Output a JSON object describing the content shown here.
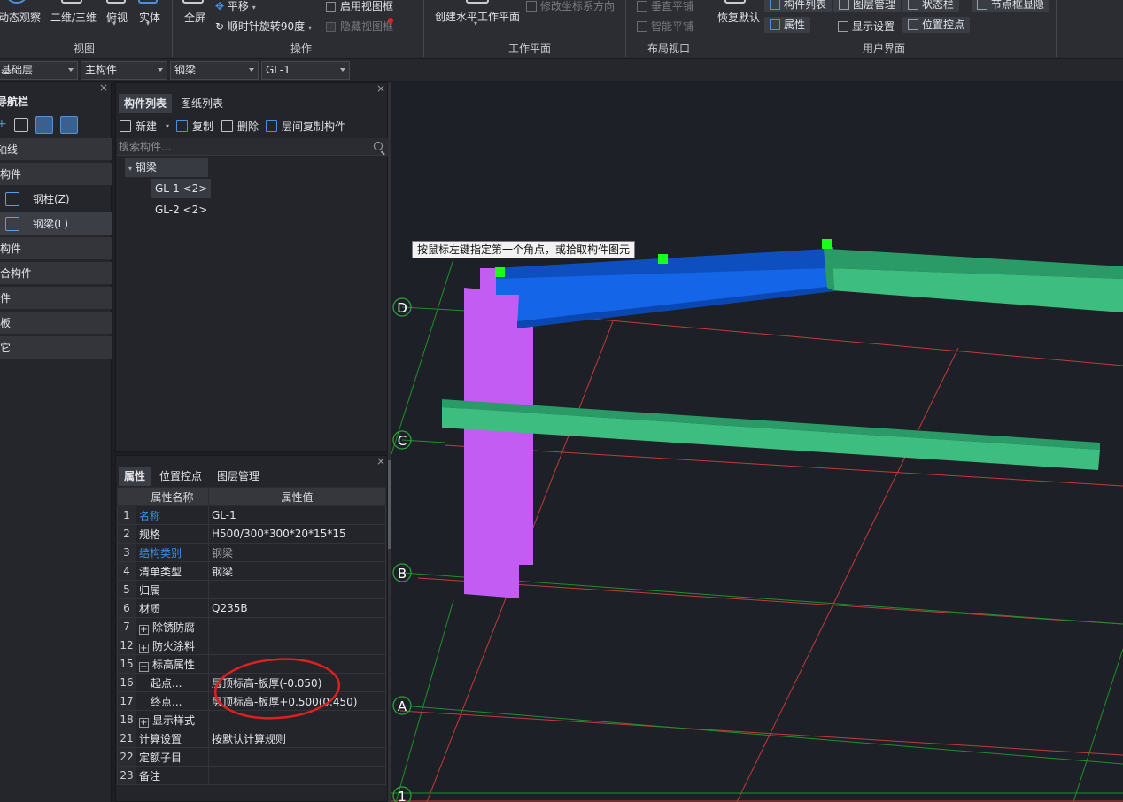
{
  "ribbon": {
    "view_group": {
      "label": "视图",
      "buttons": [
        "动态观察",
        "二维/三维",
        "俯视",
        "实体"
      ]
    },
    "ops_group": {
      "label": "操作",
      "fullscreen": "全屏",
      "pan": "平移",
      "rotate_cw": "顺时针旋转90度",
      "enable_view_frame": "启用视图框",
      "hide_view_frame": "隐藏视图框"
    },
    "workplane_group": {
      "label": "工作平面",
      "create_horizontal": "创建水平工作平面",
      "modify_coord_dir": "修改坐标系方向"
    },
    "layout_group": {
      "label": "布局视口",
      "vertical_tile": "垂直平铺",
      "smart_tile": "智能平铺"
    },
    "ui_group": {
      "label": "用户界面",
      "restore_default": "恢复默认",
      "component_list": "构件列表",
      "layer_manage": "图层管理",
      "status_bar": "状态栏",
      "node_frame_toggle": "节点框显隐",
      "properties": "属性",
      "display_settings": "显示设置",
      "position_control": "位置控点"
    }
  },
  "selectors": [
    "基础层",
    "主构件",
    "钢梁",
    "GL-1"
  ],
  "nav": {
    "title": "导航栏",
    "categories": [
      {
        "label": "轴线"
      },
      {
        "label": "主构件"
      },
      {
        "label": "次构件"
      },
      {
        "label": "组合构件"
      },
      {
        "label": "零件"
      },
      {
        "label": "面板"
      },
      {
        "label": "其它"
      }
    ],
    "sub_items": [
      {
        "label": "钢柱(Z)"
      },
      {
        "label": "钢梁(L)"
      }
    ]
  },
  "component_panel": {
    "tabs": [
      "构件列表",
      "图纸列表"
    ],
    "toolbar": {
      "new": "新建",
      "copy": "复制",
      "delete": "删除",
      "copy_floor": "层间复制构件"
    },
    "search_placeholder": "搜索构件...",
    "tree": {
      "root": "钢梁",
      "children": [
        "GL-1 <2>",
        "GL-2 <2>"
      ]
    }
  },
  "prop_panel": {
    "tabs": [
      "属性",
      "位置控点",
      "图层管理"
    ],
    "headers": [
      "属性名称",
      "属性值"
    ],
    "rows": [
      {
        "num": "1",
        "name": "名称",
        "value": "GL-1"
      },
      {
        "num": "2",
        "name": "规格",
        "value": "H500/300*300*20*15*15"
      },
      {
        "num": "3",
        "name": "结构类别",
        "value": "钢梁"
      },
      {
        "num": "4",
        "name": "清单类型",
        "value": "钢梁"
      },
      {
        "num": "5",
        "name": "归属",
        "value": ""
      },
      {
        "num": "6",
        "name": "材质",
        "value": "Q235B"
      },
      {
        "num": "7",
        "name": "除锈防腐",
        "value": ""
      },
      {
        "num": "12",
        "name": "防火涂料",
        "value": ""
      },
      {
        "num": "15",
        "name": "标高属性",
        "value": ""
      },
      {
        "num": "16",
        "name": "起点...",
        "value": "层顶标高-板厚(-0.050)"
      },
      {
        "num": "17",
        "name": "终点...",
        "value": "层顶标高-板厚+0.500(0.450)"
      },
      {
        "num": "18",
        "name": "显示样式",
        "value": ""
      },
      {
        "num": "21",
        "name": "计算设置",
        "value": "按默认计算规则"
      },
      {
        "num": "22",
        "name": "定额子目",
        "value": ""
      },
      {
        "num": "23",
        "name": "备注",
        "value": ""
      }
    ]
  },
  "viewport": {
    "tooltip": "按鼠标左键指定第一个角点，或拾取构件图元",
    "axis_labels": [
      "D",
      "C",
      "B",
      "A",
      "1"
    ],
    "colors": {
      "selected_beam": "#1565e8",
      "beam": "#2fb877",
      "column": "#c25cf2",
      "grip": "#19ff19",
      "grid_red": "#c23b3b",
      "grid_green": "#1f8f2c",
      "annotation": "#e02020"
    }
  }
}
